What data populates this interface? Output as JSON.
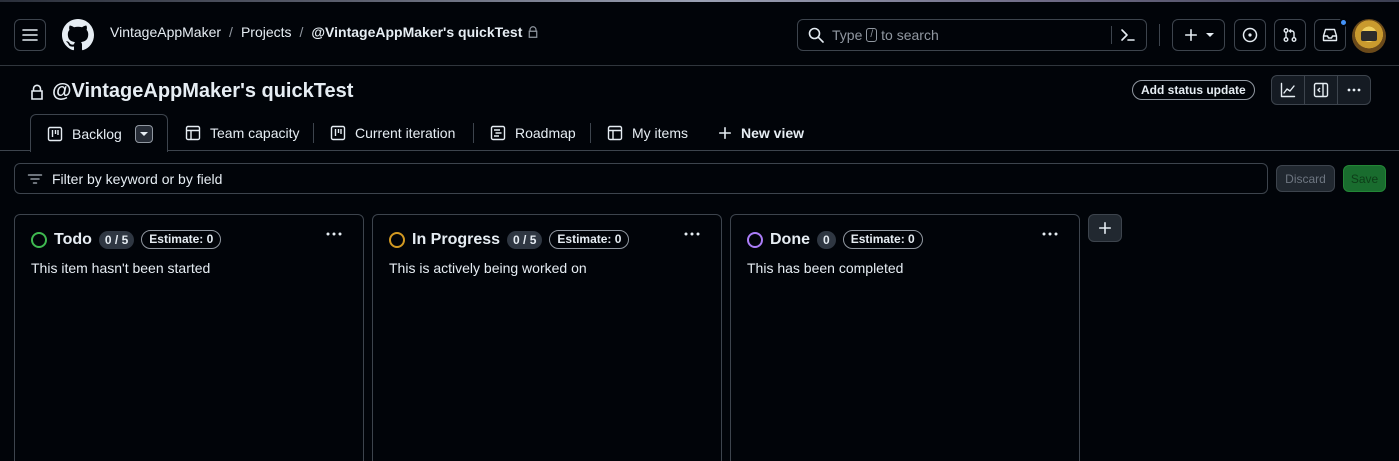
{
  "header": {
    "breadcrumbs": [
      {
        "label": "VintageAppMaker"
      },
      {
        "label": "Projects"
      },
      {
        "label": "@VintageAppMaker's quickTest"
      }
    ],
    "separator": "/",
    "search": {
      "prefix": "Type",
      "key": "/",
      "suffix": "to search"
    },
    "icons": [
      "hamburger-icon",
      "github-logo-icon",
      "search-icon",
      "command-palette-icon",
      "plus-icon",
      "caret-down-icon",
      "issues-icon",
      "pull-request-icon",
      "inbox-icon",
      "avatar"
    ]
  },
  "project": {
    "title": "@VintageAppMaker's quickTest",
    "status_button": "Add status update"
  },
  "tabs": [
    {
      "label": "Backlog"
    },
    {
      "label": "Team capacity"
    },
    {
      "label": "Current iteration"
    },
    {
      "label": "Roadmap"
    },
    {
      "label": "My items"
    },
    {
      "label": "New view"
    }
  ],
  "filter": {
    "placeholder": "Filter by keyword or by field",
    "discard_label": "Discard",
    "save_label": "Save"
  },
  "columns": [
    {
      "title": "Todo",
      "count": "0 / 5",
      "estimate": "Estimate: 0",
      "description": "This item hasn't been started",
      "color": "#3fb950"
    },
    {
      "title": "In Progress",
      "count": "0 / 5",
      "estimate": "Estimate: 0",
      "description": "This is actively being worked on",
      "color": "#d29922"
    },
    {
      "title": "Done",
      "count": "0",
      "estimate": "Estimate: 0",
      "description": "This has been completed",
      "color": "#ab7df8"
    }
  ],
  "colors": {
    "background": "#010409",
    "border": "#3d444d",
    "accent_green": "#238636",
    "notification_dot": "#4493f8"
  }
}
